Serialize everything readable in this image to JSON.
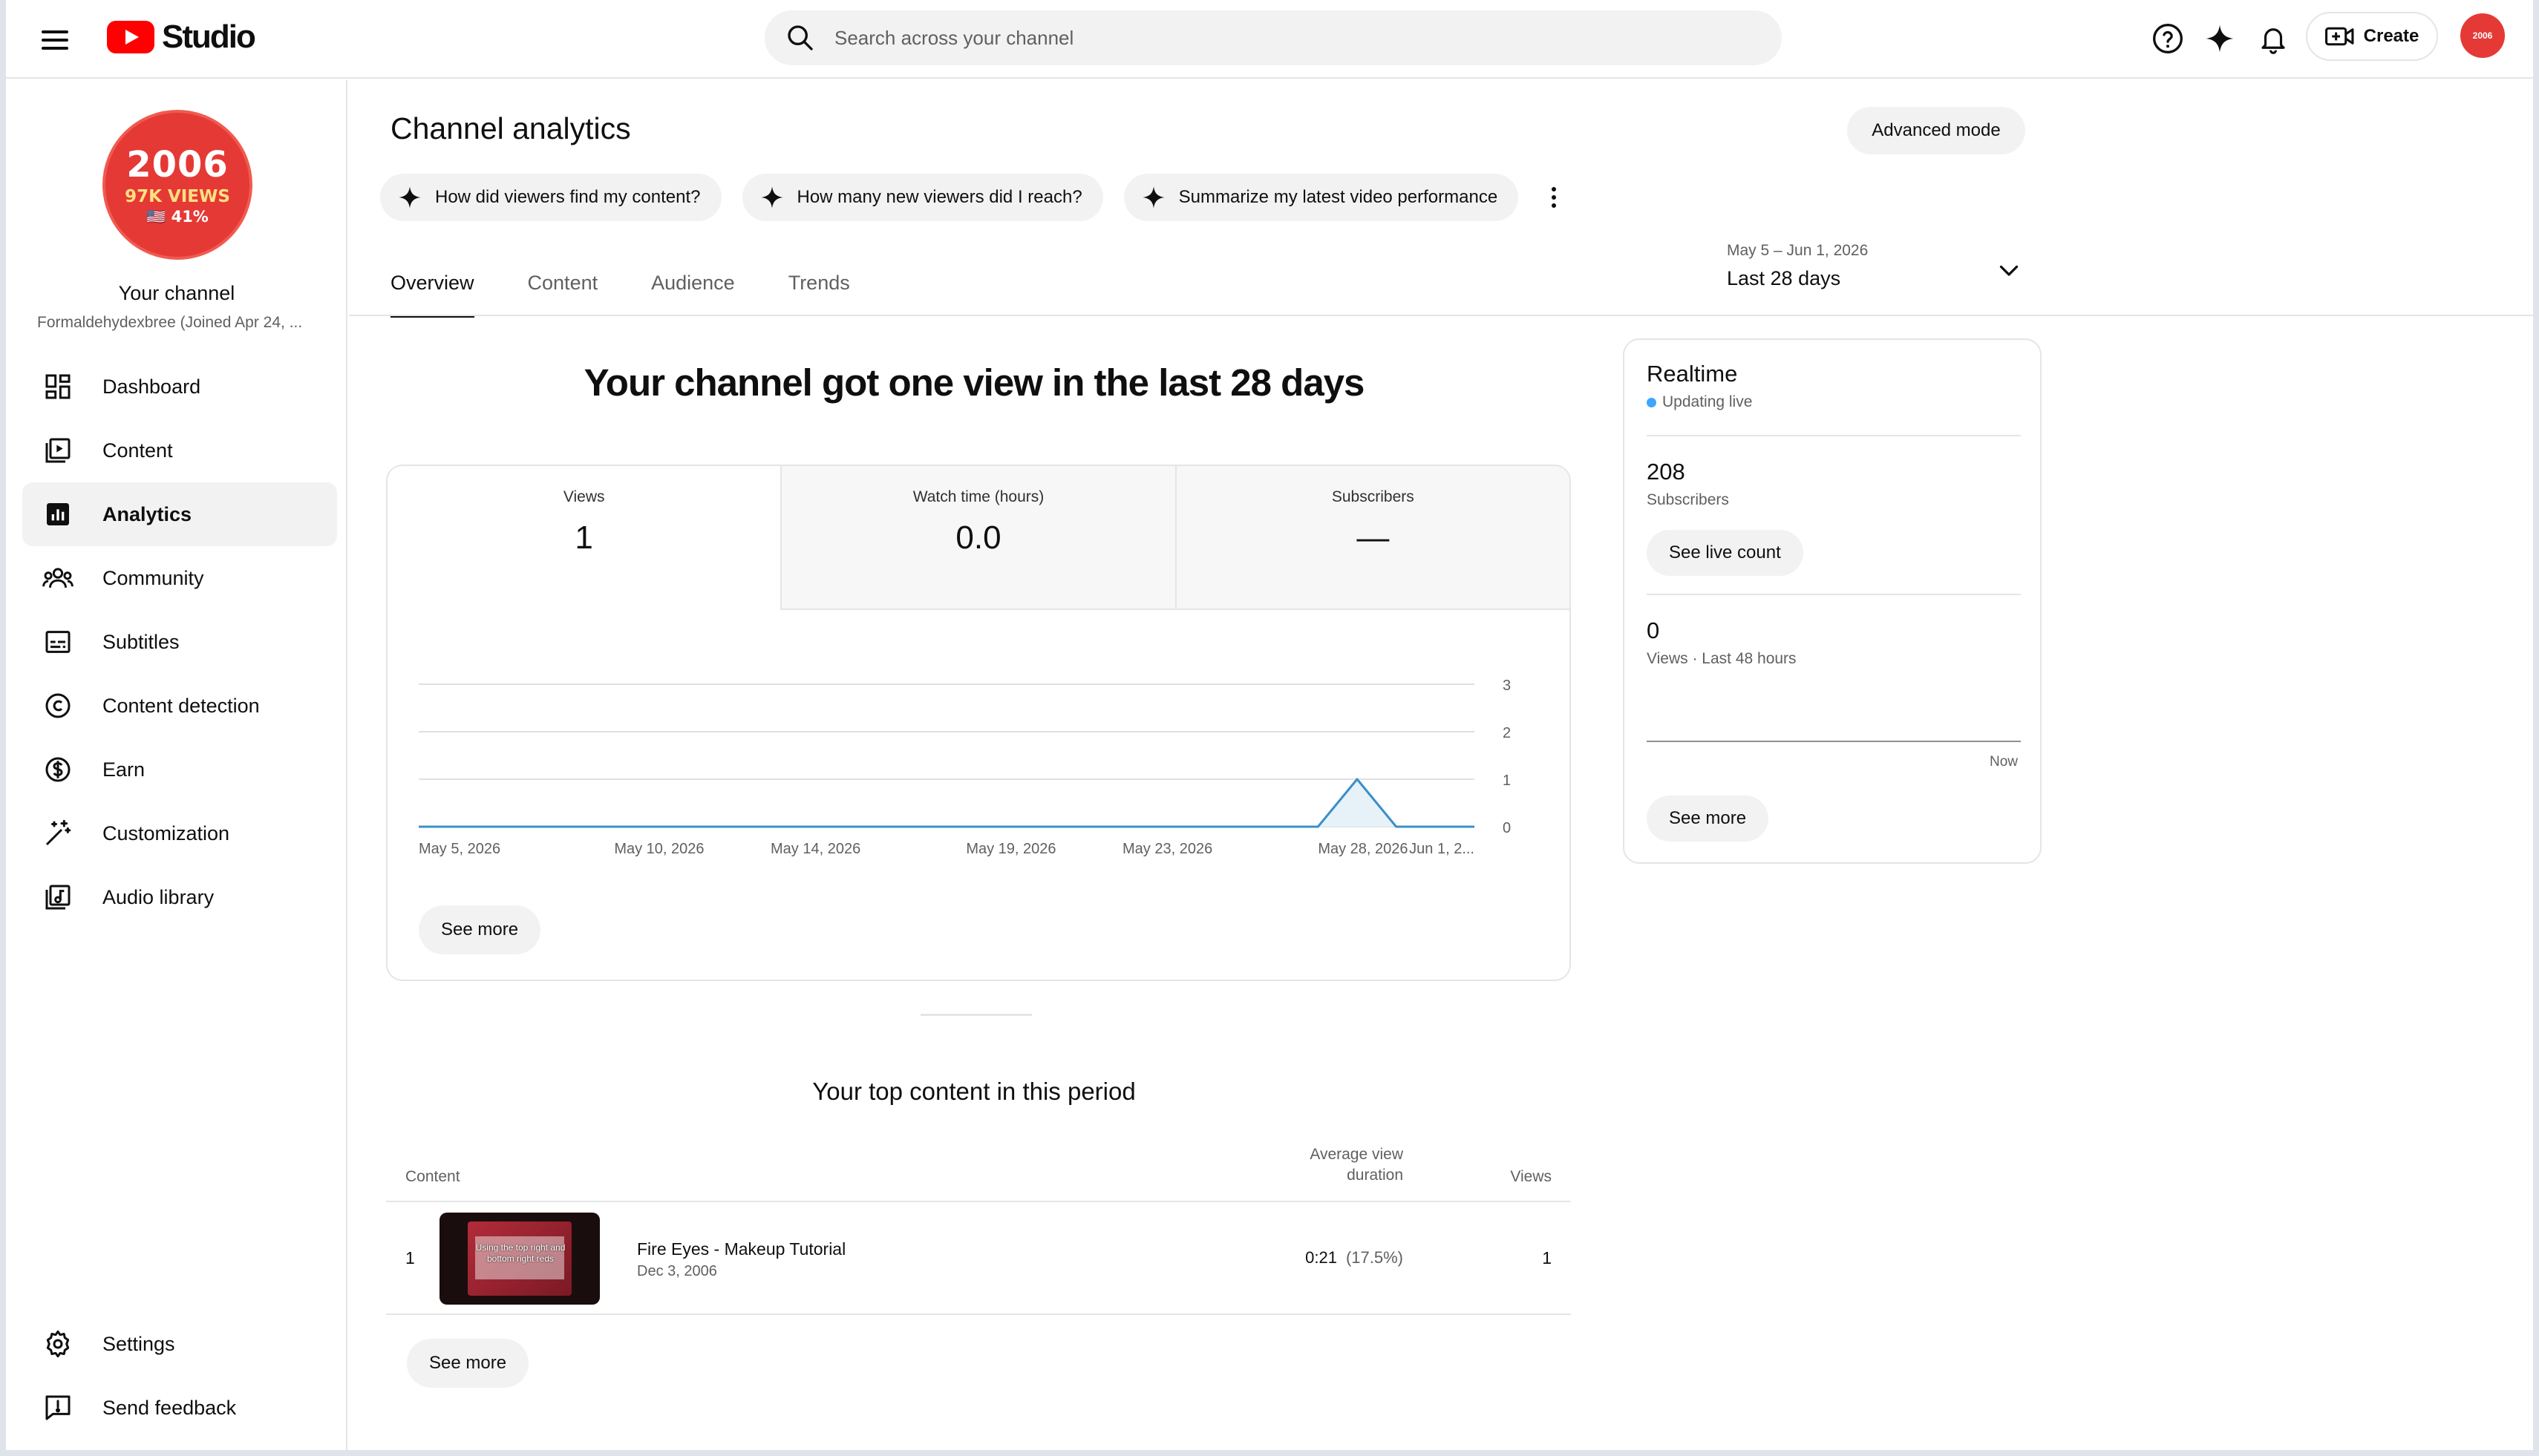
{
  "header": {
    "logo_text": "Studio",
    "search_placeholder": "Search across your channel",
    "create_label": "Create",
    "avatar_text": "2006"
  },
  "sidebar": {
    "avatar": {
      "line1": "2006",
      "line2": "97K VIEWS",
      "line3": "🇺🇸 41%"
    },
    "channel_title": "Your channel",
    "channel_subtitle": "Formaldehydexbree (Joined Apr 24, ...",
    "items": [
      {
        "label": "Dashboard",
        "icon": "dashboard-icon",
        "active": false
      },
      {
        "label": "Content",
        "icon": "content-icon",
        "active": false
      },
      {
        "label": "Analytics",
        "icon": "analytics-icon",
        "active": true
      },
      {
        "label": "Community",
        "icon": "community-icon",
        "active": false
      },
      {
        "label": "Subtitles",
        "icon": "subtitles-icon",
        "active": false
      },
      {
        "label": "Content detection",
        "icon": "copyright-icon",
        "active": false
      },
      {
        "label": "Earn",
        "icon": "dollar-icon",
        "active": false
      },
      {
        "label": "Customization",
        "icon": "magic-wand-icon",
        "active": false
      },
      {
        "label": "Audio library",
        "icon": "audio-library-icon",
        "active": false
      }
    ],
    "bottom_items": [
      {
        "label": "Settings",
        "icon": "gear-icon"
      },
      {
        "label": "Send feedback",
        "icon": "feedback-icon"
      }
    ]
  },
  "main": {
    "title": "Channel analytics",
    "advanced_mode_label": "Advanced mode",
    "suggestions": [
      "How did viewers find my content?",
      "How many new viewers did I reach?",
      "Summarize my latest video performance"
    ],
    "date_range": {
      "range": "May 5 – Jun 1, 2026",
      "label": "Last 28 days"
    },
    "tabs": [
      "Overview",
      "Content",
      "Audience",
      "Trends"
    ],
    "active_tab": "Overview",
    "headline": "Your channel got one view in the last 28 days",
    "metrics": [
      {
        "label": "Views",
        "value": "1"
      },
      {
        "label": "Watch time (hours)",
        "value": "0.0"
      },
      {
        "label": "Subscribers",
        "value": "—"
      }
    ],
    "see_more_label": "See more",
    "top_content": {
      "title": "Your top content in this period",
      "columns": {
        "content": "Content",
        "avd_line1": "Average view",
        "avd_line2": "duration",
        "views": "Views"
      },
      "rows": [
        {
          "rank": "1",
          "title": "Fire Eyes - Makeup Tutorial",
          "date": "Dec 3, 2006",
          "avd": "0:21",
          "avd_pct": "(17.5%)",
          "views": "1",
          "thumb_text": "Using the top right and bottom right reds"
        }
      ],
      "see_more_label": "See more"
    }
  },
  "realtime": {
    "title": "Realtime",
    "status": "Updating live",
    "subscribers_value": "208",
    "subscribers_label": "Subscribers",
    "live_count_label": "See live count",
    "views_value": "0",
    "views_label": "Views · Last 48 hours",
    "now_label": "Now",
    "see_more_label": "See more"
  },
  "chart_data": {
    "type": "line",
    "x": [
      "May 5, 2026",
      "May 6",
      "May 7",
      "May 8",
      "May 9",
      "May 10, 2026",
      "May 11",
      "May 12",
      "May 13",
      "May 14, 2026",
      "May 15",
      "May 16",
      "May 17",
      "May 18",
      "May 19, 2026",
      "May 20",
      "May 21",
      "May 22",
      "May 23, 2026",
      "May 24",
      "May 25",
      "May 26",
      "May 27",
      "May 28, 2026",
      "May 29",
      "May 30",
      "May 31",
      "Jun 1, 2026"
    ],
    "series": [
      {
        "values": [
          0,
          0,
          0,
          0,
          0,
          0,
          0,
          0,
          0,
          0,
          0,
          0,
          0,
          0,
          0,
          0,
          0,
          0,
          0,
          0,
          0,
          0,
          0,
          0,
          1,
          0,
          0,
          0
        ]
      }
    ],
    "xtick_labels": [
      "May 5, 2026",
      "May 10, 2026",
      "May 14, 2026",
      "May 19, 2026",
      "May 23, 2026",
      "May 28, 2026",
      "Jun 1, 2..."
    ],
    "xtick_indices": [
      0,
      5,
      9,
      14,
      18,
      23,
      27
    ],
    "yticks": [
      0,
      1,
      2,
      3
    ],
    "ylim": [
      0,
      3
    ],
    "grid": true,
    "color": "#3a8fc9"
  }
}
